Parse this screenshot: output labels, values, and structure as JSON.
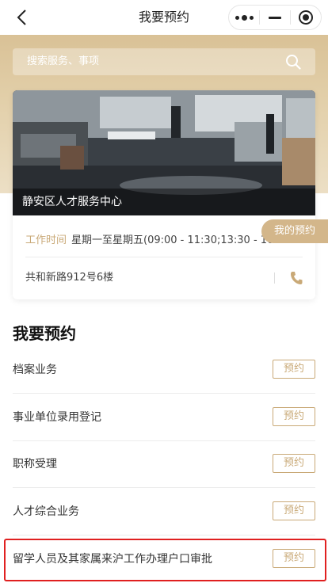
{
  "nav": {
    "title": "我要预约",
    "back_icon": "chevron-left-icon",
    "more_icon": "more-dots-icon",
    "minimize_icon": "minimize-icon",
    "close_icon": "target-close-icon"
  },
  "search": {
    "placeholder": "搜索服务、事项",
    "icon": "search-icon"
  },
  "center": {
    "name": "静安区人才服务中心",
    "hours_label": "工作时间",
    "hours_value": "星期一至星期五(09:00 - 11:30;13:30 - 16...",
    "address": "共和新路912号6楼",
    "phone_icon": "phone-icon"
  },
  "my_booking": "我的预约",
  "section_title": "我要预约",
  "items": [
    {
      "label": "档案业务",
      "button": "预约"
    },
    {
      "label": "事业单位录用登记",
      "button": "预约"
    },
    {
      "label": "职称受理",
      "button": "预约"
    },
    {
      "label": "人才综合业务",
      "button": "预约"
    },
    {
      "label": "留学人员及其家属来沪工作办理户口审批",
      "button": "预约"
    }
  ],
  "colors": {
    "accent": "#c9a977",
    "band": "#d9c196",
    "highlight": "#e02020"
  }
}
